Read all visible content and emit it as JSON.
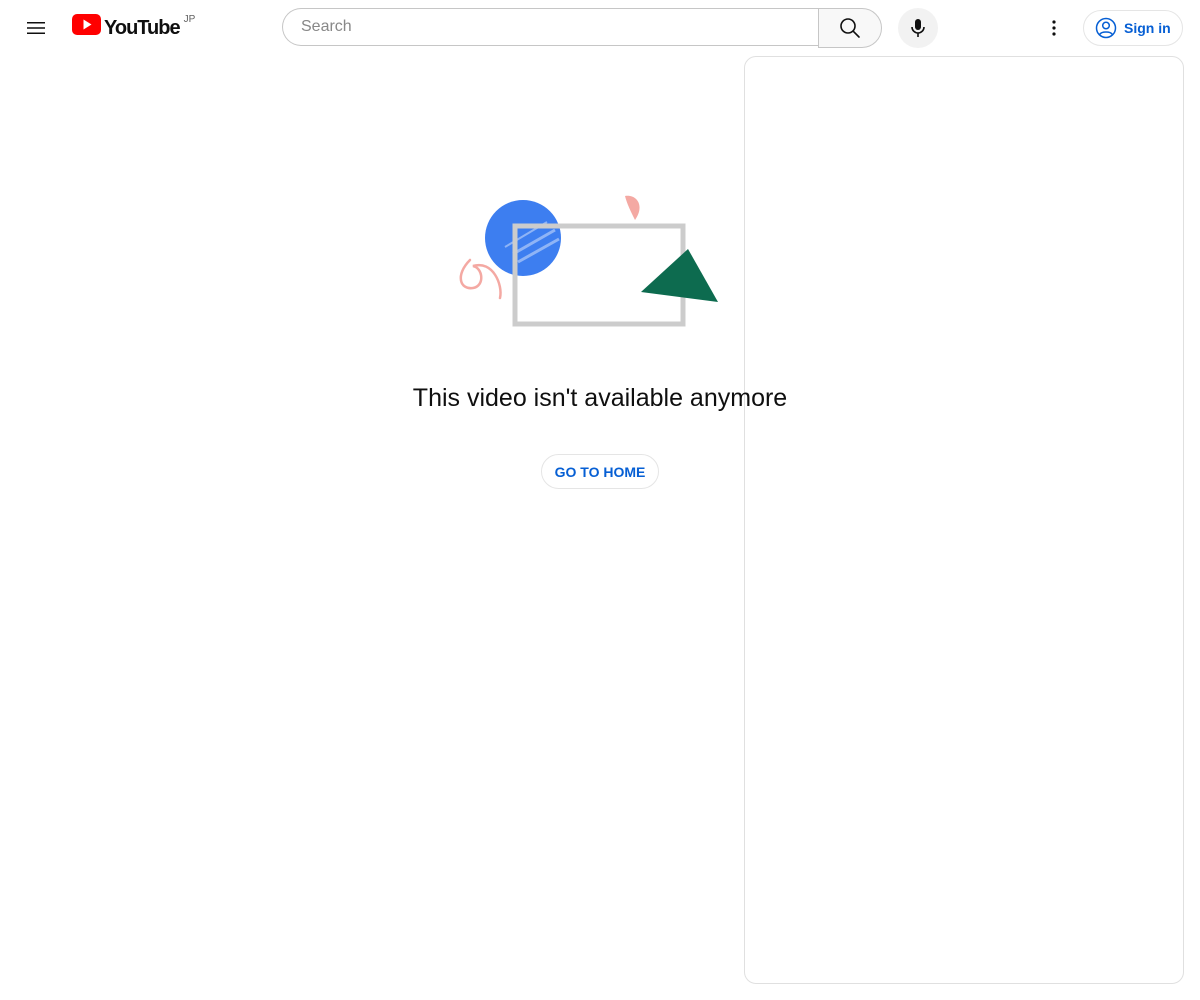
{
  "header": {
    "logo_text": "YouTube",
    "country_code": "JP",
    "search_placeholder": "Search",
    "sign_in_label": "Sign in",
    "icons": {
      "menu": "hamburger-menu-icon",
      "search": "search-icon",
      "mic": "microphone-icon",
      "more": "more-vertical-icon",
      "account": "account-circle-icon"
    }
  },
  "main": {
    "error_message": "This video isn't available anymore",
    "home_button_label": "GO TO HOME"
  },
  "colors": {
    "brand_red": "#ff0000",
    "link_blue": "#065fd4",
    "circle_blue": "#3d7ef0",
    "triangle_green": "#0d6b4f",
    "accent_pink": "#f4a9a3",
    "frame_gray": "#cccccc"
  }
}
